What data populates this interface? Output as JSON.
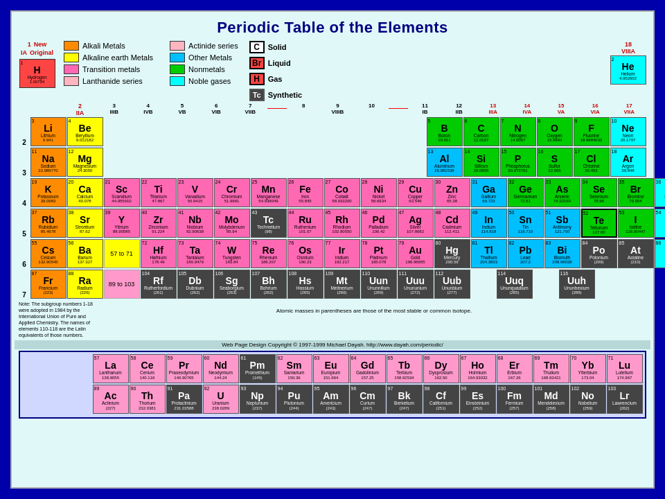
{
  "title": "Periodic Table of the Elements",
  "legend": {
    "items": [
      {
        "label": "Alkali Metals",
        "color": "#ff8c00"
      },
      {
        "label": "Alkaline earth Metals",
        "color": "#ffff00"
      },
      {
        "label": "Transition metals",
        "color": "#ff69b4"
      },
      {
        "label": "Lanthanide series",
        "color": "#ffb6c1"
      },
      {
        "label": "Actinide series",
        "color": "#ffb6c1"
      },
      {
        "label": "Other Metals",
        "color": "#00bfff"
      },
      {
        "label": "Nonmetals",
        "color": "#00cc00"
      },
      {
        "label": "Noble gases",
        "color": "#00ffff"
      }
    ],
    "state_solid": "Solid",
    "state_liquid": "Liquid",
    "state_gas": "Gas",
    "state_synthetic": "Synthetic",
    "state_solid_sym": "C",
    "state_liquid_sym": "Br",
    "state_gas_sym": "H",
    "state_synthetic_sym": "Tc"
  },
  "note": "Atomic masses in parentheses are those of the most stable or common isotope.",
  "copyright": "Web Page Design Copyright © 1997-1999 Michael Dayah. http://www.dayah.com/periodic/",
  "side_note": "Note: The subgroup numbers 1-18 were adopted in 1984 by the International Union of Pure and Applied Chemistry. The names of elements 110-118 are the Latin equivalents of those numbers."
}
